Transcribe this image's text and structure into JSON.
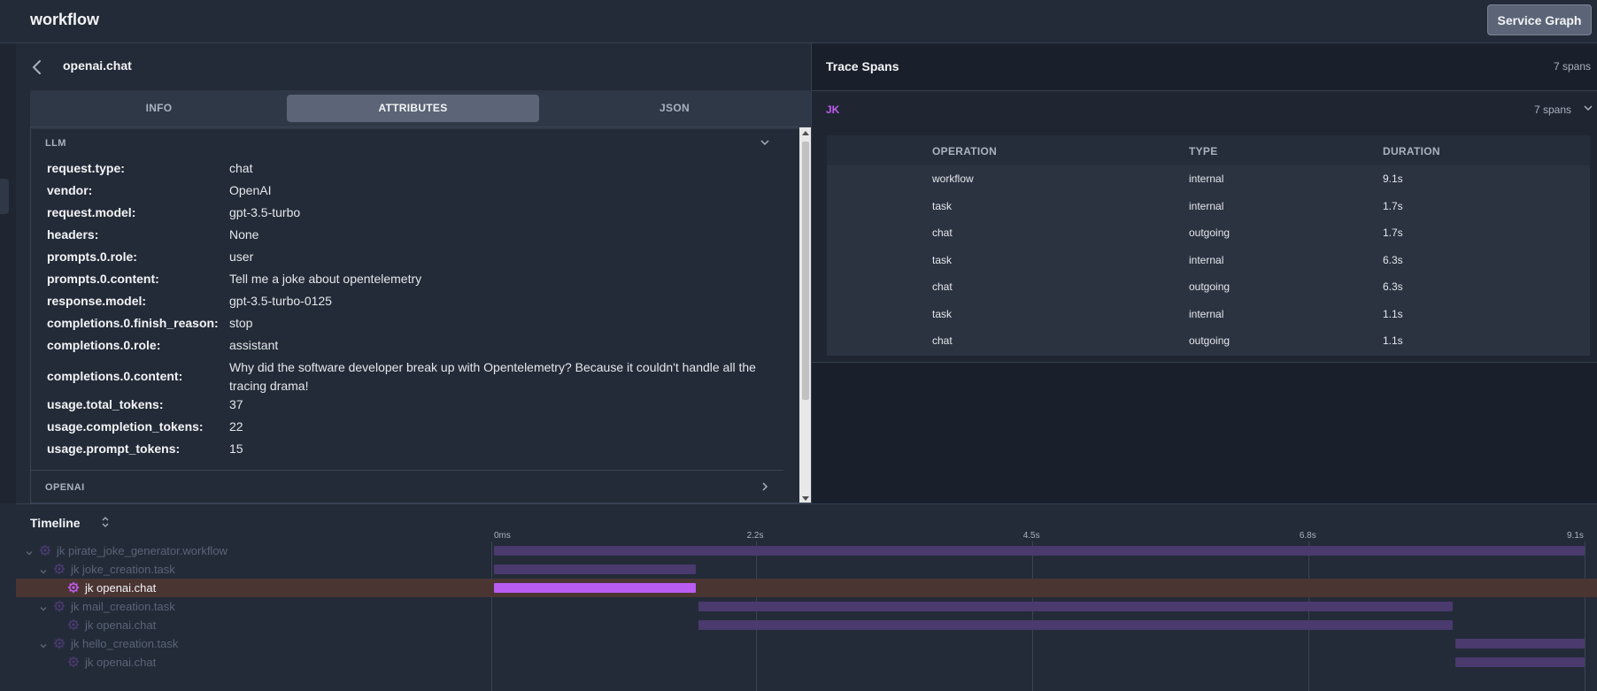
{
  "app": {
    "title": "workflow",
    "service_graph_label": "Service Graph"
  },
  "details": {
    "span_title": "openai.chat",
    "tabs": [
      "INFO",
      "ATTRIBUTES",
      "JSON"
    ],
    "active_tab": "ATTRIBUTES",
    "sections": [
      {
        "label": "LLM",
        "expanded": true,
        "attributes": [
          {
            "key": "request.type:",
            "value": "chat"
          },
          {
            "key": "vendor:",
            "value": "OpenAI"
          },
          {
            "key": "request.model:",
            "value": "gpt-3.5-turbo"
          },
          {
            "key": "headers:",
            "value": "None"
          },
          {
            "key": "prompts.0.role:",
            "value": "user"
          },
          {
            "key": "prompts.0.content:",
            "value": "Tell me a joke about opentelemetry"
          },
          {
            "key": "response.model:",
            "value": "gpt-3.5-turbo-0125"
          },
          {
            "key": "completions.0.finish_reason:",
            "value": "stop"
          },
          {
            "key": "completions.0.role:",
            "value": "assistant"
          },
          {
            "key": "completions.0.content:",
            "value": "Why did the software developer break up with Opentelemetry? Because it couldn't handle all the tracing drama!"
          },
          {
            "key": "usage.total_tokens:",
            "value": "37"
          },
          {
            "key": "usage.completion_tokens:",
            "value": "22"
          },
          {
            "key": "usage.prompt_tokens:",
            "value": "15"
          }
        ]
      },
      {
        "label": "OPENAI",
        "expanded": false,
        "attributes": []
      }
    ]
  },
  "trace_spans": {
    "title": "Trace Spans",
    "count_label": "7 spans",
    "group": {
      "name": "JK",
      "count_label": "7 spans",
      "columns": [
        "OPERATION",
        "TYPE",
        "DURATION"
      ],
      "rows": [
        {
          "operation": "workflow",
          "type": "internal",
          "duration": "9.1s"
        },
        {
          "operation": "task",
          "type": "internal",
          "duration": "1.7s"
        },
        {
          "operation": "chat",
          "type": "outgoing",
          "duration": "1.7s"
        },
        {
          "operation": "task",
          "type": "internal",
          "duration": "6.3s"
        },
        {
          "operation": "chat",
          "type": "outgoing",
          "duration": "6.3s"
        },
        {
          "operation": "task",
          "type": "internal",
          "duration": "1.1s"
        },
        {
          "operation": "chat",
          "type": "outgoing",
          "duration": "1.1s"
        }
      ]
    }
  },
  "timeline": {
    "title": "Timeline",
    "axis_labels": [
      "0ms",
      "2.2s",
      "4.5s",
      "6.8s",
      "9.1s"
    ],
    "axis_values": [
      0,
      2.2,
      4.5,
      6.8,
      9.1
    ],
    "total_seconds": 9.1,
    "colors": {
      "bar": "#4a3a6e",
      "selected_bar": "#b85cf2",
      "selected_row": "#4a3533",
      "service": "#c25cf2"
    },
    "rows": [
      {
        "service": "jk",
        "name": "pirate_joke_generator.workflow",
        "depth": 0,
        "has_children": true,
        "start": 0.0,
        "end": 9.1,
        "selected": false
      },
      {
        "service": "jk",
        "name": "joke_creation.task",
        "depth": 1,
        "has_children": true,
        "start": 0.0,
        "end": 1.7,
        "selected": false
      },
      {
        "service": "jk",
        "name": "openai.chat",
        "depth": 2,
        "has_children": false,
        "start": 0.0,
        "end": 1.7,
        "selected": true
      },
      {
        "service": "jk",
        "name": "mail_creation.task",
        "depth": 1,
        "has_children": true,
        "start": 1.7,
        "end": 8.0,
        "selected": false
      },
      {
        "service": "jk",
        "name": "openai.chat",
        "depth": 2,
        "has_children": false,
        "start": 1.7,
        "end": 8.0,
        "selected": false
      },
      {
        "service": "jk",
        "name": "hello_creation.task",
        "depth": 1,
        "has_children": true,
        "start": 8.0,
        "end": 9.1,
        "selected": false
      },
      {
        "service": "jk",
        "name": "openai.chat",
        "depth": 2,
        "has_children": false,
        "start": 8.0,
        "end": 9.1,
        "selected": false
      }
    ]
  }
}
